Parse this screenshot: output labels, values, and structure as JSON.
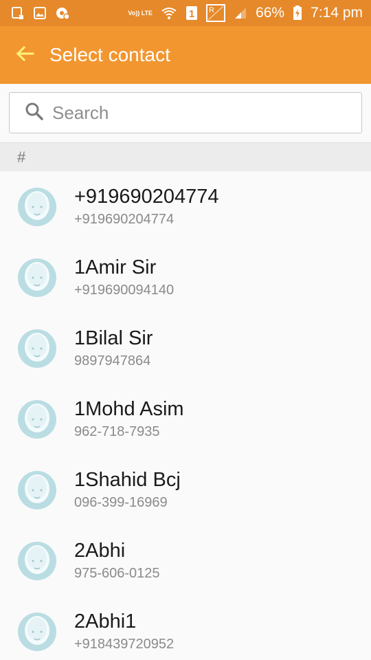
{
  "status_bar": {
    "network": "Vo)) LTE",
    "sim": "1",
    "roaming": "R",
    "battery_percent": "66%",
    "time": "7:14 pm"
  },
  "app_bar": {
    "title": "Select contact"
  },
  "search": {
    "placeholder": "Search",
    "value": ""
  },
  "section": {
    "header": "#"
  },
  "contacts": [
    {
      "name": "+919690204774",
      "number": "+919690204774"
    },
    {
      "name": "1Amir Sir",
      "number": "+919690094140"
    },
    {
      "name": "1Bilal Sir",
      "number": "9897947864"
    },
    {
      "name": "1Mohd Asim",
      "number": "962-718-7935"
    },
    {
      "name": "1Shahid Bcj",
      "number": "096-399-16969"
    },
    {
      "name": "2Abhi",
      "number": "975-606-0125"
    },
    {
      "name": "2Abhi1",
      "number": "+918439720952"
    }
  ],
  "colors": {
    "status_bar": "#e5892a",
    "app_bar": "#f29630",
    "back_arrow": "#fff27a",
    "avatar_bg": "#b9dde2",
    "avatar_face": "#f4fbfc"
  }
}
